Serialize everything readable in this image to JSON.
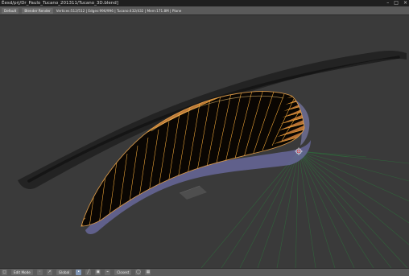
{
  "window": {
    "title": "Ẽesd/prj/Dr_Paulo_Tucano_201311/Tucano_3D.blend]",
    "controls": [
      "–",
      "□",
      "×"
    ]
  },
  "info_bar": {
    "layout_label": "Default",
    "engine_label": "Blender Render",
    "stats": "Vertices:512/512 | Edges:996/996 | Tucano:432/432 | Mem:171.8M | Plane"
  },
  "mode_bar": {
    "mode_label": "Edit Mode",
    "orientation_label": "Global",
    "snap_label": "Closest",
    "icons": [
      "view-icon",
      "select-icon",
      "mesh-icon",
      "mode-icon",
      "pivot-icon",
      "manipulator-icon",
      "vertex-select-icon",
      "edge-select-icon",
      "face-select-icon",
      "snap-icon",
      "proportional-icon",
      "layers-icon"
    ]
  },
  "colors": {
    "viewport_bg": "#3a3a3a",
    "mesh_fill": "#c8782f",
    "mesh_edge": "#ffb23b",
    "mesh_outline": "#e6a14a",
    "pointcloud_dark": "#111111",
    "pointcloud_grey": "#6a6aa0",
    "camera_rays": "#2f6b3c"
  }
}
